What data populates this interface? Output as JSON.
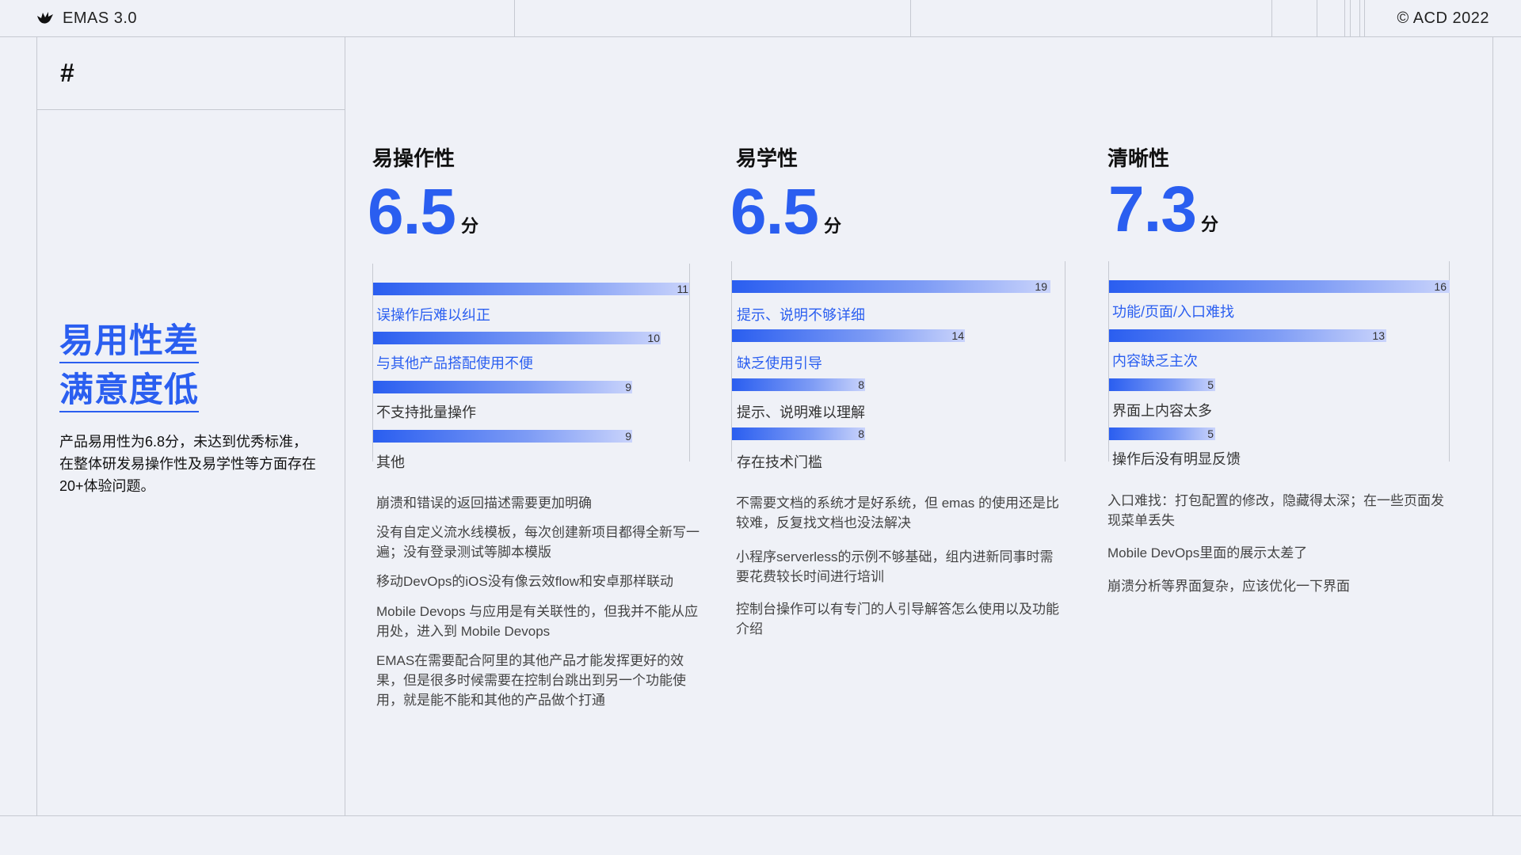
{
  "header": {
    "brand": "EMAS 3.0",
    "copyright": "© ACD 2022"
  },
  "side": {
    "hash": "#",
    "headline": [
      "易用性差",
      "满意度低"
    ],
    "summary": "产品易用性为6.8分，未达到优秀标准，在整体研发易操作性及易学性等方面存在20+体验问题。"
  },
  "metrics": [
    {
      "title": "易操作性",
      "score": "6.5",
      "unit": "分",
      "bars": [
        {
          "label": "误操作后难以纠正",
          "value": "11",
          "highlight": true
        },
        {
          "label": "与其他产品搭配使用不便",
          "value": "10",
          "highlight": true
        },
        {
          "label": "不支持批量操作",
          "value": "9",
          "highlight": false
        },
        {
          "label": "其他",
          "value": "9",
          "highlight": false
        }
      ],
      "comments": [
        "崩溃和错误的返回描述需要更加明确",
        "没有自定义流水线模板，每次创建新项目都得全新写一遍；没有登录测试等脚本模版",
        "移动DevOps的iOS没有像云效flow和安卓那样联动",
        "Mobile Devops 与应用是有关联性的，但我并不能从应用处，进入到 Mobile Devops",
        "EMAS在需要配合阿里的其他产品才能发挥更好的效果，但是很多时候需要在控制台跳出到另一个功能使用，就是能不能和其他的产品做个打通"
      ]
    },
    {
      "title": "易学性",
      "score": "6.5",
      "unit": "分",
      "bars": [
        {
          "label": "提示、说明不够详细",
          "value": "19",
          "highlight": true
        },
        {
          "label": "缺乏使用引导",
          "value": "14",
          "highlight": true
        },
        {
          "label": "提示、说明难以理解",
          "value": "8",
          "highlight": false
        },
        {
          "label": "存在技术门槛",
          "value": "8",
          "highlight": false
        }
      ],
      "comments": [
        "不需要文档的系统才是好系统，但 emas 的使用还是比较难，反复找文档也没法解决",
        "小程序serverless的示例不够基础，组内进新同事时需要花费较长时间进行培训",
        "控制台操作可以有专门的人引导解答怎么使用以及功能介绍"
      ]
    },
    {
      "title": "清晰性",
      "score": "7.3",
      "unit": "分",
      "bars": [
        {
          "label": "功能/页面/入口难找",
          "value": "16",
          "highlight": true
        },
        {
          "label": "内容缺乏主次",
          "value": "13",
          "highlight": true
        },
        {
          "label": "界面上内容太多",
          "value": "5",
          "highlight": false
        },
        {
          "label": "操作后没有明显反馈",
          "value": "5",
          "highlight": false
        }
      ],
      "comments": [
        "入口难找：打包配置的修改，隐藏得太深；在一些页面发现菜单丢失",
        "Mobile DevOps里面的展示太差了",
        "崩溃分析等界面复杂，应该优化一下界面"
      ]
    }
  ],
  "colors": {
    "accent": "#2a5ef0",
    "background": "#eff1f7",
    "rule": "#c6c9d1"
  }
}
